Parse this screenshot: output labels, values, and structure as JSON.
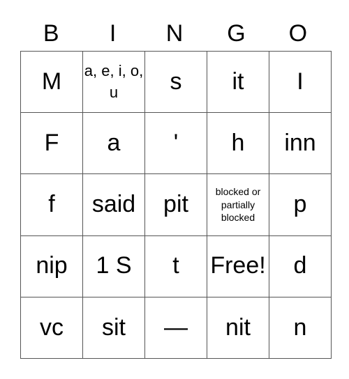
{
  "header": [
    "B",
    "I",
    "N",
    "G",
    "O"
  ],
  "rows": [
    [
      {
        "text": "M"
      },
      {
        "text": "a, e, i, o, u",
        "size": "medium"
      },
      {
        "text": "s"
      },
      {
        "text": "it"
      },
      {
        "text": "I"
      }
    ],
    [
      {
        "text": "F"
      },
      {
        "text": "a"
      },
      {
        "text": "'"
      },
      {
        "text": "h"
      },
      {
        "text": "inn"
      }
    ],
    [
      {
        "text": "f"
      },
      {
        "text": "said"
      },
      {
        "text": "pit"
      },
      {
        "text": "blocked or partially blocked",
        "size": "small"
      },
      {
        "text": "p"
      }
    ],
    [
      {
        "text": "nip"
      },
      {
        "text": "1 S"
      },
      {
        "text": "t"
      },
      {
        "text": "Free!"
      },
      {
        "text": "d"
      }
    ],
    [
      {
        "text": "vc"
      },
      {
        "text": "sit"
      },
      {
        "text": "—"
      },
      {
        "text": "nit"
      },
      {
        "text": "n"
      }
    ]
  ]
}
